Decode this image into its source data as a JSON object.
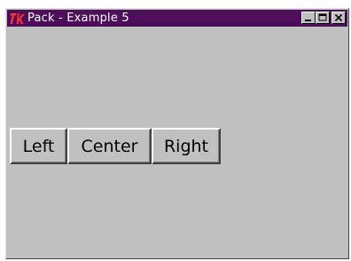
{
  "window": {
    "title": "Pack - Example 5",
    "icon": "tk-logo-icon",
    "title_bar_color": "#4d0f5a",
    "controls": [
      "minimize-icon",
      "maximize-icon",
      "close-icon"
    ]
  },
  "buttons": {
    "left_label": "Left",
    "center_label": "Center",
    "right_label": "Right"
  }
}
